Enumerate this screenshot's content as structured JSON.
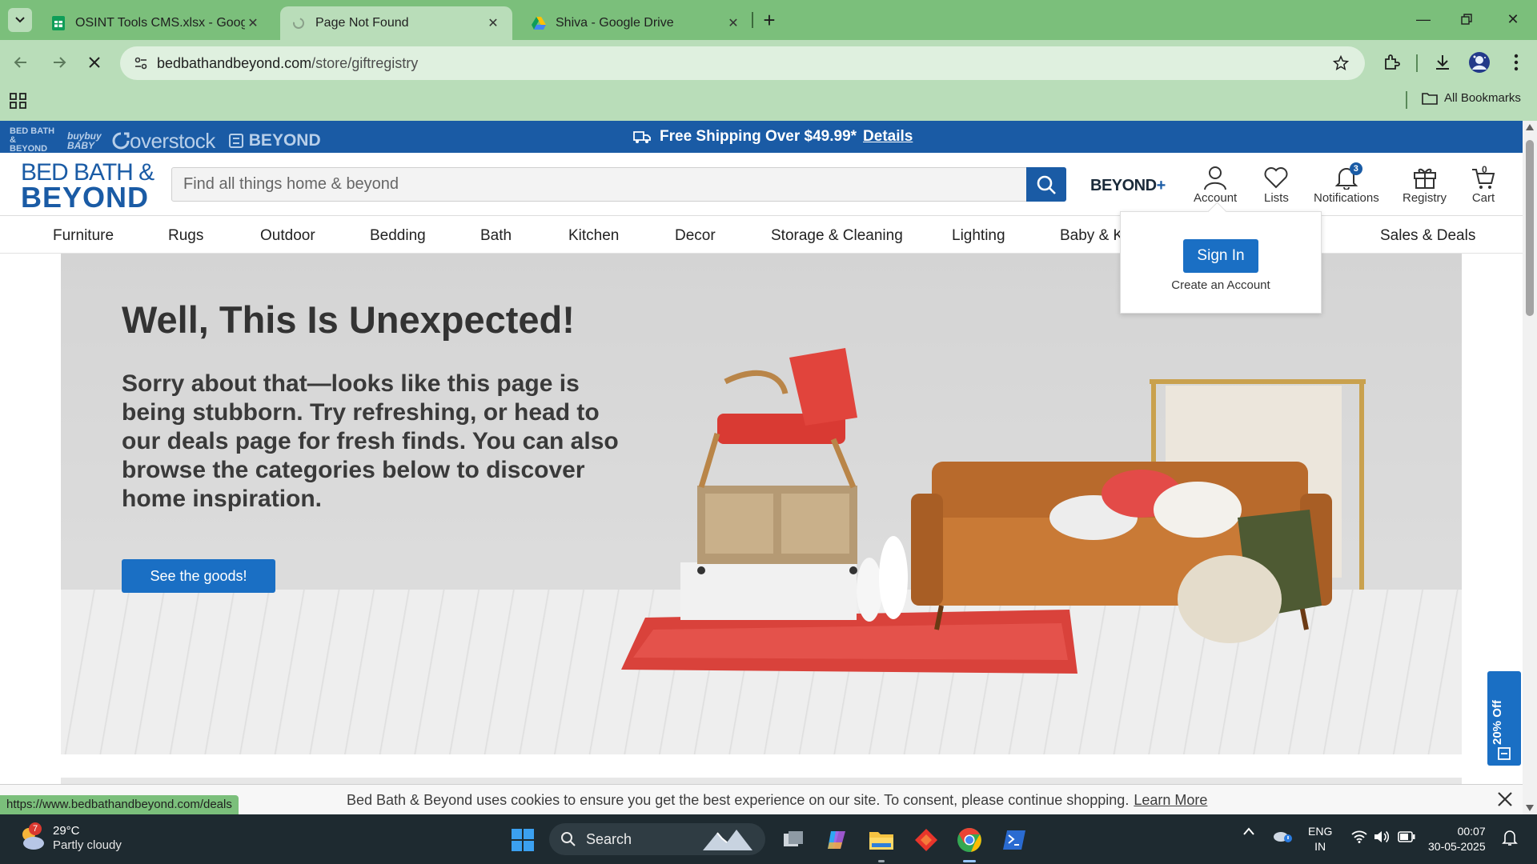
{
  "browser": {
    "tabs": [
      {
        "title": "OSINT Tools CMS.xlsx - Google",
        "favicon": "sheets-icon",
        "active": false
      },
      {
        "title": "Page Not Found",
        "favicon": "loading-icon",
        "active": true
      },
      {
        "title": "Shiva - Google Drive",
        "favicon": "drive-icon",
        "active": false
      }
    ],
    "url_host": "bedbathandbeyond.com",
    "url_path": "/store/giftregistry",
    "all_bookmarks": "All Bookmarks",
    "chrome_color": "#7bbf7b"
  },
  "promo": {
    "family": [
      "BED BATH & BEYOND",
      "buybuy BABY",
      "overstock",
      "BEYOND"
    ],
    "message": "Free Shipping Over $49.99*",
    "details": "Details"
  },
  "header": {
    "logo_line1": "BED BATH &",
    "logo_line2": "BEYOND",
    "search_placeholder": "Find all things home & beyond",
    "beyond_plus": "BEYOND",
    "beyond_plus_sign": "+",
    "account": "Account",
    "lists": "Lists",
    "notifications": "Notifications",
    "notifications_count": "3",
    "registry": "Registry",
    "cart": "Cart",
    "cart_count": "0",
    "brand_color": "#1a5ba5"
  },
  "categories": [
    "Furniture",
    "Rugs",
    "Outdoor",
    "Bedding",
    "Bath",
    "Kitchen",
    "Decor",
    "Storage & Cleaning",
    "Lighting",
    "Baby & K",
    "Sales & Deals"
  ],
  "hero": {
    "title": "Well, This Is Unexpected!",
    "body": "Sorry about that—looks like this page is being stubborn. Try refreshing, or head to our deals page for fresh finds. You can also browse the categories below to discover home inspiration.",
    "cta": "See the goods!"
  },
  "account_popover": {
    "sign_in": "Sign In",
    "create": "Create an Account"
  },
  "discount_tab": "20% Off",
  "cookie_bar": {
    "message": "Bed Bath & Beyond uses cookies to ensure you get the best experience on our site. To consent, please continue shopping.",
    "learn_more": "Learn More"
  },
  "status_url": "https://www.bedbathandbeyond.com/deals",
  "taskbar": {
    "weather_badge": "7",
    "temperature": "29°C",
    "condition": "Partly cloudy",
    "search": "Search",
    "lang1": "ENG",
    "lang2": "IN",
    "time": "00:07",
    "date": "30-05-2025"
  }
}
